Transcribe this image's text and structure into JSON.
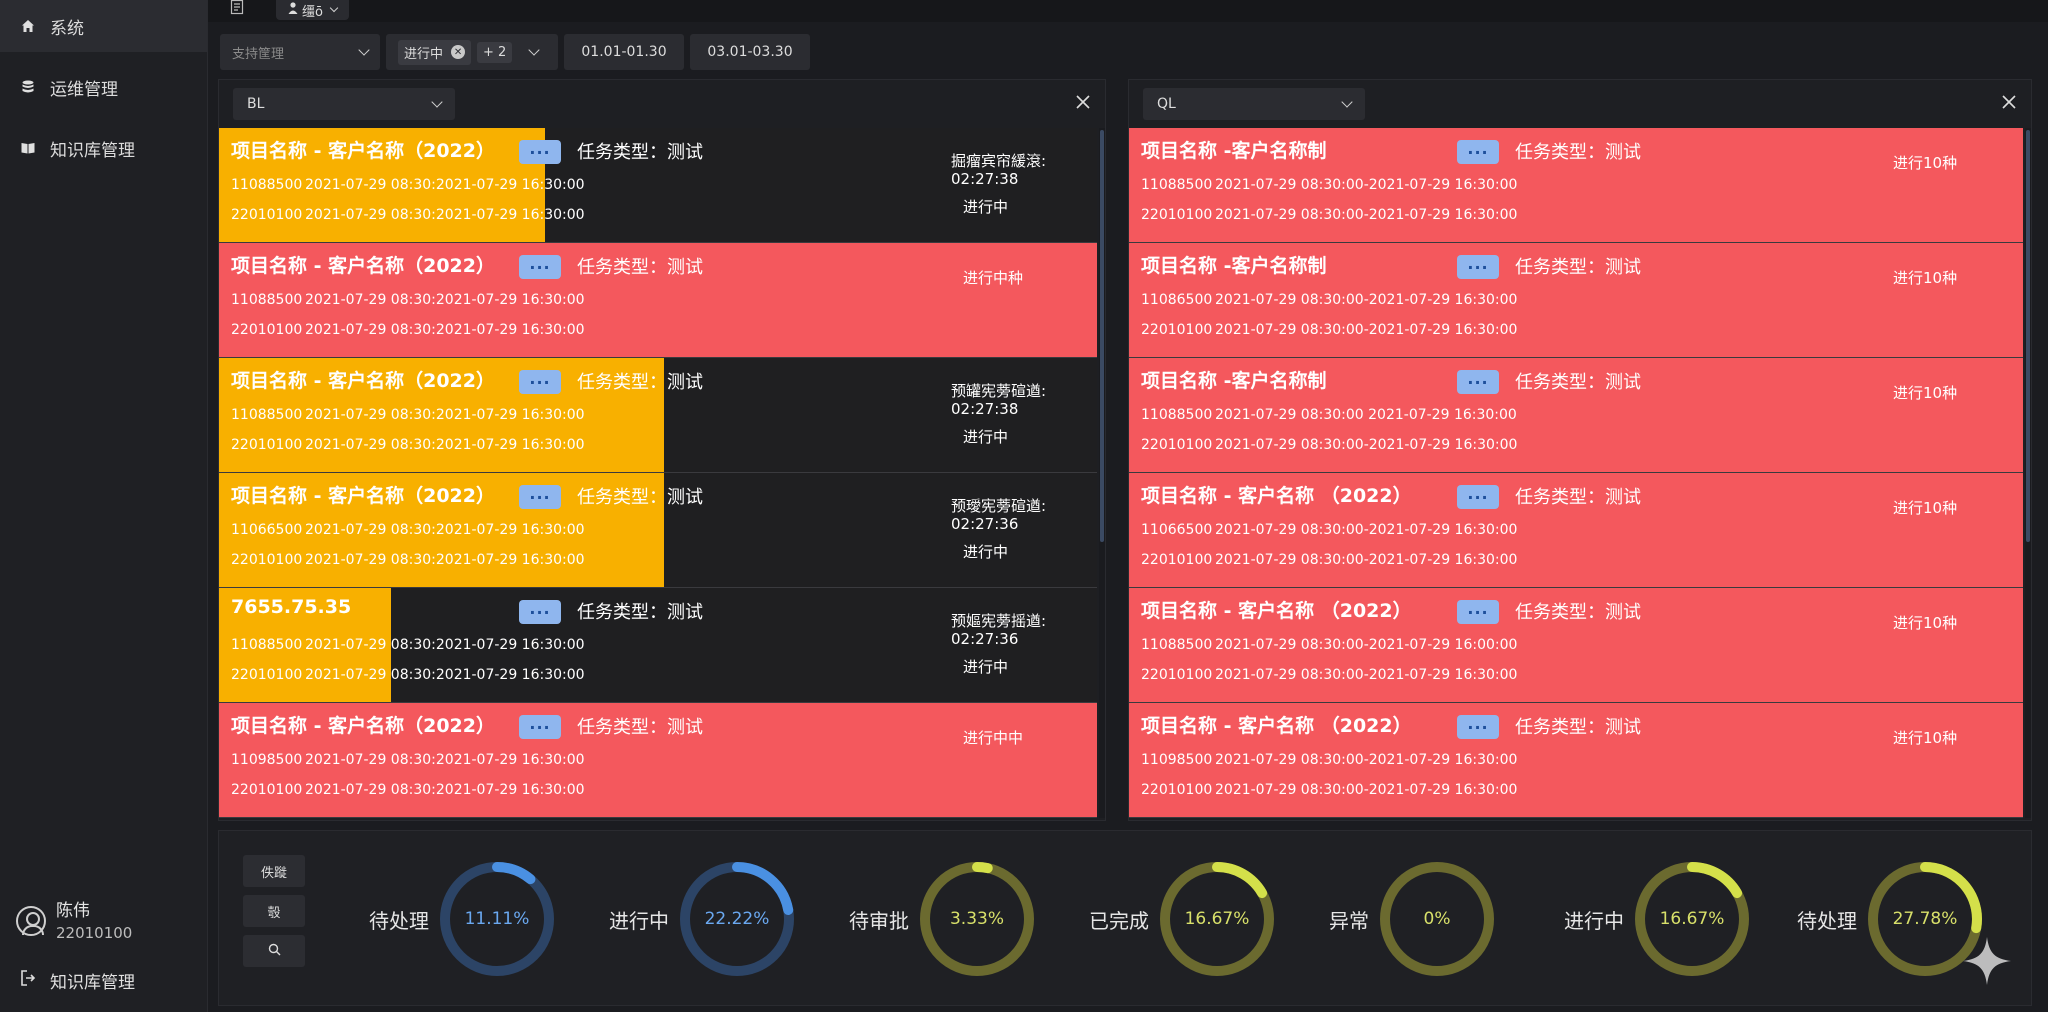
{
  "sidebar": {
    "items": [
      {
        "label": "系统",
        "icon": "home-icon"
      },
      {
        "label": "运维管理",
        "icon": "database-icon"
      },
      {
        "label": "知识库管理",
        "icon": "book-icon"
      }
    ],
    "user": {
      "name": "陈伟",
      "id": "22010100"
    },
    "bottom_link": "知识库管理"
  },
  "topbar": {
    "tab_label": "缰ō"
  },
  "filters": {
    "select_placeholder": "支持筐理",
    "status_chip": "进行中",
    "status_more": "+ 2",
    "date1": "01.01-01.30",
    "date2": "03.01-03.30"
  },
  "colors": {
    "orange": "#f8b000",
    "red": "#f4585d",
    "blue": "#4a90e2",
    "olive": "#c9d64a"
  },
  "left_panel": {
    "select": "BL",
    "rows": [
      {
        "title": "项目名称 - 客户名称（2022）",
        "type": "任务类型：测试",
        "l1_code": "11088500",
        "l1_time": "2021-07-29 08:30:2021-07-29 16:30:00",
        "l2_code": "22010100",
        "l2_time": "2021-07-29 08:30:2021-07-29 16:30:00",
        "stat_title": "掘瘤宾帘緩滾:",
        "stat_time": "02:27:38",
        "status": "进行中"
      },
      {
        "title": "项目名称 - 客户名称（2022）",
        "type": "任务类型：测试",
        "l1_code": "11088500",
        "l1_time": "2021-07-29 08:30:2021-07-29 16:30:00",
        "l2_code": "22010100",
        "l2_time": "2021-07-29 08:30:2021-07-29 16:30:00",
        "status": "进行中种"
      },
      {
        "title": "项目名称 - 客户名称（2022）",
        "type": "任务类型：测试",
        "l1_code": "11088500",
        "l1_time": "2021-07-29 08:30:2021-07-29 16:30:00",
        "l2_code": "22010100",
        "l2_time": "2021-07-29 08:30:2021-07-29 16:30:00",
        "stat_title": "预罐宪蒡碹遒:",
        "stat_time": "02:27:38",
        "status": "进行中"
      },
      {
        "title": "项目名称 - 客户名称（2022）",
        "type": "任务类型：测试",
        "l1_code": "11066500",
        "l1_time": "2021-07-29 08:30:2021-07-29 16:30:00",
        "l2_code": "22010100",
        "l2_time": "2021-07-29 08:30:2021-07-29 16:30:00",
        "stat_title": "预璦宪蒡碹遒:",
        "stat_time": "02:27:36",
        "status": "进行中"
      },
      {
        "title": "7655.75.35",
        "type": "任务类型：测试",
        "l1_code": "11088500",
        "l1_time": "2021-07-29 08:30:2021-07-29 16:30:00",
        "l2_code": "22010100",
        "l2_time": "2021-07-29 08:30:2021-07-29 16:30:00",
        "stat_title": "预嫗宪蒡摇遒:",
        "stat_time": "02:27:36",
        "status": "进行中"
      },
      {
        "title": "项目名称 - 客户名称（2022）",
        "type": "任务类型：测试",
        "l1_code": "11098500",
        "l1_time": "2021-07-29 08:30:2021-07-29 16:30:00",
        "l2_code": "22010100",
        "l2_time": "2021-07-29 08:30:2021-07-29 16:30:00",
        "status": "进行中中"
      }
    ]
  },
  "right_panel": {
    "select": "QL",
    "rows": [
      {
        "title": "项目名称 -客户名称制",
        "type": "任务类型：测试",
        "l1_code": "11088500",
        "l1_time": "2021-07-29 08:30:00-2021-07-29 16:30:00",
        "l2_code": "22010100",
        "l2_time": "2021-07-29 08:30:00-2021-07-29 16:30:00",
        "status": "进行10种"
      },
      {
        "title": "项目名称 -客户名称制",
        "type": "任务类型：测试",
        "l1_code": "11086500",
        "l1_time": "2021-07-29 08:30:00-2021-07-29 16:30:00",
        "l2_code": "22010100",
        "l2_time": "2021-07-29 08:30:00-2021-07-29 16:30:00",
        "status": "进行10种"
      },
      {
        "title": "项目名称 -客户名称制",
        "type": "任务类型：测试",
        "l1_code": "11088500",
        "l1_time": "2021-07-29 08:30:00 2021-07-29 16:30:00",
        "l2_code": "22010100",
        "l2_time": "2021-07-29 08:30:00-2021-07-29 16:30:00",
        "status": "进行10种"
      },
      {
        "title": "项目名称 - 客户名称 （2022）",
        "type": "任务类型：测试",
        "l1_code": "11066500",
        "l1_time": "2021-07-29 08:30:00-2021-07-29 16:30:00",
        "l2_code": "22010100",
        "l2_time": "2021-07-29 08:30:00-2021-07-29 16:30:00",
        "status": "进行10种"
      },
      {
        "title": "项目名称 - 客户名称 （2022）",
        "type": "任务类型：测试",
        "l1_code": "11088500",
        "l1_time": "2021-07-29 08:30:00-2021-07-29 16:00:00",
        "l2_code": "22010100",
        "l2_time": "2021-07-29 08:30:00-2021-07-29 16:30:00",
        "status": "进行10种"
      },
      {
        "title": "项目名称 - 客户名称 （2022）",
        "type": "任务类型：测试",
        "l1_code": "11098500",
        "l1_time": "2021-07-29 08:30:00-2021-07-29 16:30:00",
        "l2_code": "22010100",
        "l2_time": "2021-07-29 08:30:00-2021-07-29 16:30:00",
        "status": "进行10种"
      }
    ]
  },
  "bottom_buttons": [
    "佚蹝",
    "彀",
    "search-icon"
  ],
  "stats": [
    {
      "label": "待处理",
      "value": "11.11%",
      "fraction": 0.1111,
      "color": "#4a90e2",
      "track": "#2c4466",
      "text": "#6aa8f0"
    },
    {
      "label": "进行中",
      "value": "22.22%",
      "fraction": 0.2222,
      "color": "#4a90e2",
      "track": "#2c4466",
      "text": "#6aa8f0"
    },
    {
      "label": "待审批",
      "value": "3.33%",
      "fraction": 0.0333,
      "color": "#d4e04a",
      "track": "#6b6a2f",
      "text": "#d8e06a"
    },
    {
      "label": "已完成",
      "value": "16.67%",
      "fraction": 0.1667,
      "color": "#d4e04a",
      "track": "#6b6a2f",
      "text": "#d8e06a"
    },
    {
      "label": "异常",
      "value": "0%",
      "fraction": 0,
      "color": "#d4e04a",
      "track": "#6b6a2f",
      "text": "#d8e06a"
    },
    {
      "label": "进行中",
      "value": "16.67%",
      "fraction": 0.1667,
      "color": "#d4e04a",
      "track": "#6b6a2f",
      "text": "#d8e06a"
    },
    {
      "label": "待处理",
      "value": "27.78%",
      "fraction": 0.2778,
      "color": "#d4e04a",
      "track": "#6b6a2f",
      "text": "#d8e06a"
    }
  ]
}
